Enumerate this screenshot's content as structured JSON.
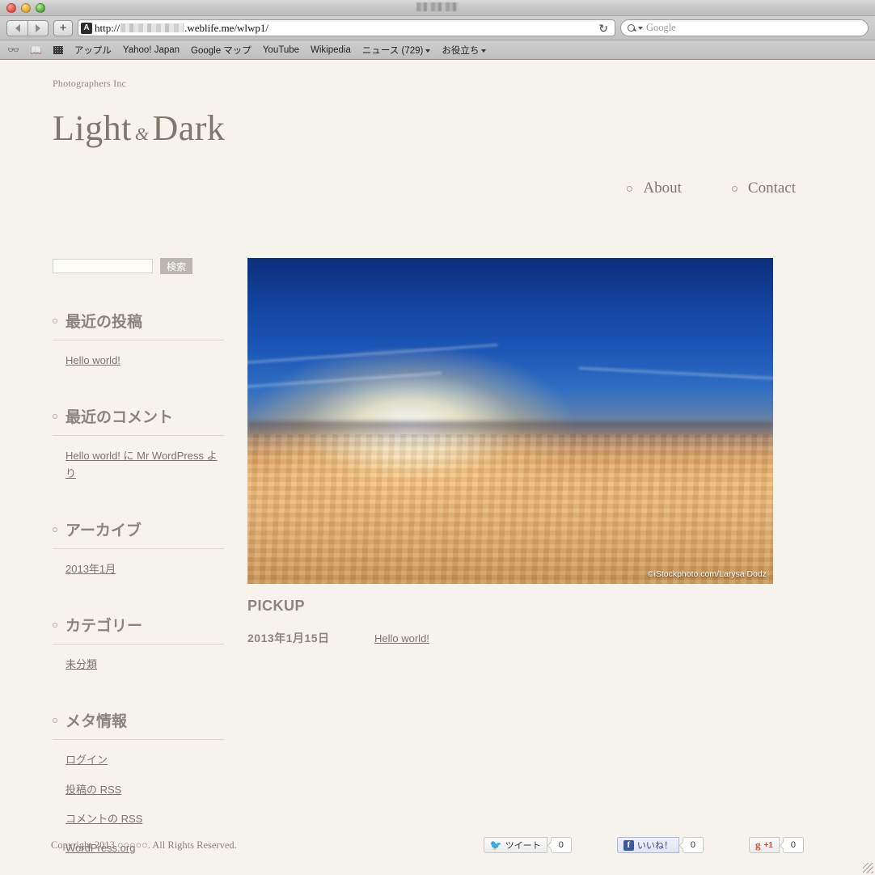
{
  "browser": {
    "window_title_redacted": true,
    "nav": {
      "back_icon": "triangle-left-icon",
      "forward_icon": "triangle-right-icon",
      "new_tab_label": "+"
    },
    "url": {
      "reader_badge": "A",
      "scheme": "http://",
      "host_suffix": ".weblife.me/wlwp1/",
      "reload_icon": "↻"
    },
    "search": {
      "placeholder": "Google",
      "icon": "magnifier-icon"
    },
    "bookmarks": [
      {
        "label": "アップル",
        "has_menu": false
      },
      {
        "label": "Yahoo! Japan",
        "has_menu": false
      },
      {
        "label": "Google マップ",
        "has_menu": false
      },
      {
        "label": "YouTube",
        "has_menu": false
      },
      {
        "label": "Wikipedia",
        "has_menu": false
      },
      {
        "label": "ニュース (729)",
        "has_menu": true
      },
      {
        "label": "お役立ち",
        "has_menu": true
      }
    ]
  },
  "site": {
    "tagline": "Photographers Inc",
    "title_first": "Light",
    "title_amp": "&",
    "title_second": "Dark",
    "nav": [
      {
        "label": "About"
      },
      {
        "label": "Contact"
      }
    ]
  },
  "sidebar": {
    "search": {
      "value": "",
      "button_label": "検索"
    },
    "widgets": [
      {
        "title": "最近の投稿",
        "items": [
          {
            "text": "Hello world!",
            "link": true
          }
        ]
      },
      {
        "title": "最近のコメント",
        "items": [
          {
            "text": "Hello world! に Mr WordPress より",
            "link": true
          }
        ]
      },
      {
        "title": "アーカイブ",
        "items": [
          {
            "text": "2013年1月",
            "link": true
          }
        ]
      },
      {
        "title": "カテゴリー",
        "items": [
          {
            "text": "未分類",
            "link": true
          }
        ]
      },
      {
        "title": "メタ情報",
        "items": [
          {
            "text": "ログイン",
            "link": true
          },
          {
            "text": "投稿の RSS",
            "link": true
          },
          {
            "text": "コメントの RSS",
            "link": true
          },
          {
            "text": "WordPress.org",
            "link": true
          }
        ]
      }
    ]
  },
  "main": {
    "hero_credit": "©iStockphoto.com/Larysa Dodz",
    "pickup_title": "PICKUP",
    "pickup_date": "2013年1月15日",
    "pickup_link": "Hello world!"
  },
  "footer": {
    "copyright": "Copyright 2013 ○○○○○. All Rights Reserved.",
    "social": [
      {
        "network": "twitter",
        "label": "ツイート",
        "count": "0"
      },
      {
        "network": "facebook",
        "label": "いいね！",
        "count": "0"
      },
      {
        "network": "googleplus",
        "label": "+1",
        "count": "0"
      }
    ]
  },
  "colors": {
    "page_bg": "#f6f3ec",
    "text": "#7a756b",
    "heading": "#8a857b",
    "rule": "#ddd8cd"
  }
}
